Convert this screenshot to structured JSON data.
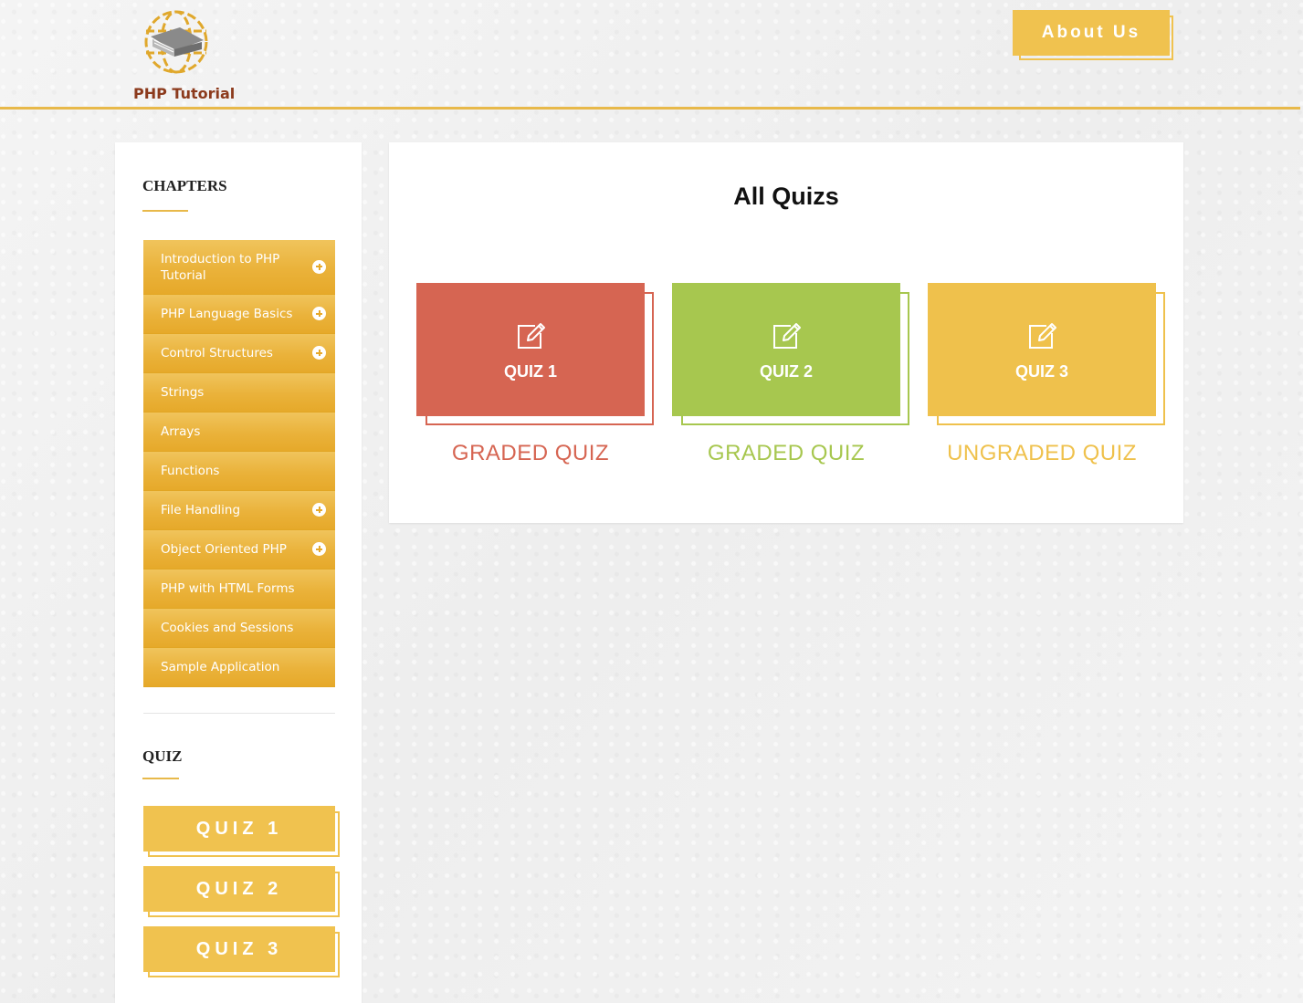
{
  "header": {
    "logo_text": "PHP Tutorial",
    "about_label": "About Us"
  },
  "sidebar": {
    "chapters_heading": "CHAPTERS",
    "chapters": [
      {
        "label": "Introduction to PHP Tutorial",
        "expandable": true
      },
      {
        "label": "PHP Language Basics",
        "expandable": true
      },
      {
        "label": "Control Structures",
        "expandable": true
      },
      {
        "label": "Strings",
        "expandable": false
      },
      {
        "label": "Arrays",
        "expandable": false
      },
      {
        "label": "Functions",
        "expandable": false
      },
      {
        "label": "File Handling",
        "expandable": true
      },
      {
        "label": "Object Oriented PHP",
        "expandable": true
      },
      {
        "label": "PHP with HTML Forms",
        "expandable": false
      },
      {
        "label": "Cookies and Sessions",
        "expandable": false
      },
      {
        "label": "Sample Application",
        "expandable": false
      }
    ],
    "quiz_heading": "QUIZ",
    "quiz_buttons": [
      "QUIZ 1",
      "QUIZ 2",
      "QUIZ 3"
    ]
  },
  "main": {
    "title": "All Quizs",
    "cards": [
      {
        "label": "QUIZ 1",
        "type": "GRADED QUIZ",
        "color": "#d66552",
        "icon": "edit-icon"
      },
      {
        "label": "QUIZ 2",
        "type": "GRADED QUIZ",
        "color": "#a7c74f",
        "icon": "edit-icon"
      },
      {
        "label": "QUIZ 3",
        "type": "UNGRADED QUIZ",
        "color": "#efc14c",
        "icon": "edit-icon"
      }
    ]
  },
  "colors": {
    "accent": "#e8b94a",
    "button": "#f0c24f",
    "logo_text": "#8c3a1c"
  }
}
